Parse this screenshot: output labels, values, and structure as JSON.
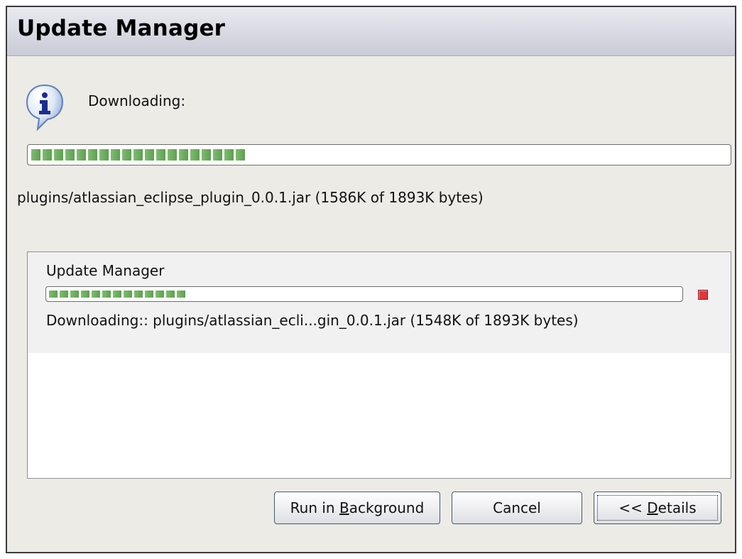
{
  "window": {
    "title": "Update Manager"
  },
  "status": {
    "icon": "info-icon",
    "label": "Downloading:",
    "progress_fraction": 0.31,
    "progress_segments": 19,
    "file_text": "plugins/atlassian_eclipse_plugin_0.0.1.jar (1586K of 1893K bytes)"
  },
  "details": {
    "job": {
      "name": "Update Manager",
      "progress_fraction": 0.22,
      "progress_segments": 13,
      "status_text": "Downloading:: plugins/atlassian_ecli...gin_0.0.1.jar (1548K of 1893K bytes)",
      "stop_icon": "stop-icon",
      "stop_color": "#e0363d"
    }
  },
  "buttons": {
    "run_in_background": {
      "before": "Run in ",
      "mnemonic": "B",
      "after": "ackground"
    },
    "cancel": {
      "label": "Cancel"
    },
    "details": {
      "before": "<< ",
      "mnemonic": "D",
      "after": "etails"
    }
  },
  "colors": {
    "progress_green": "#6aae5c",
    "title_text": "#000000",
    "button_border": "#44596f"
  }
}
